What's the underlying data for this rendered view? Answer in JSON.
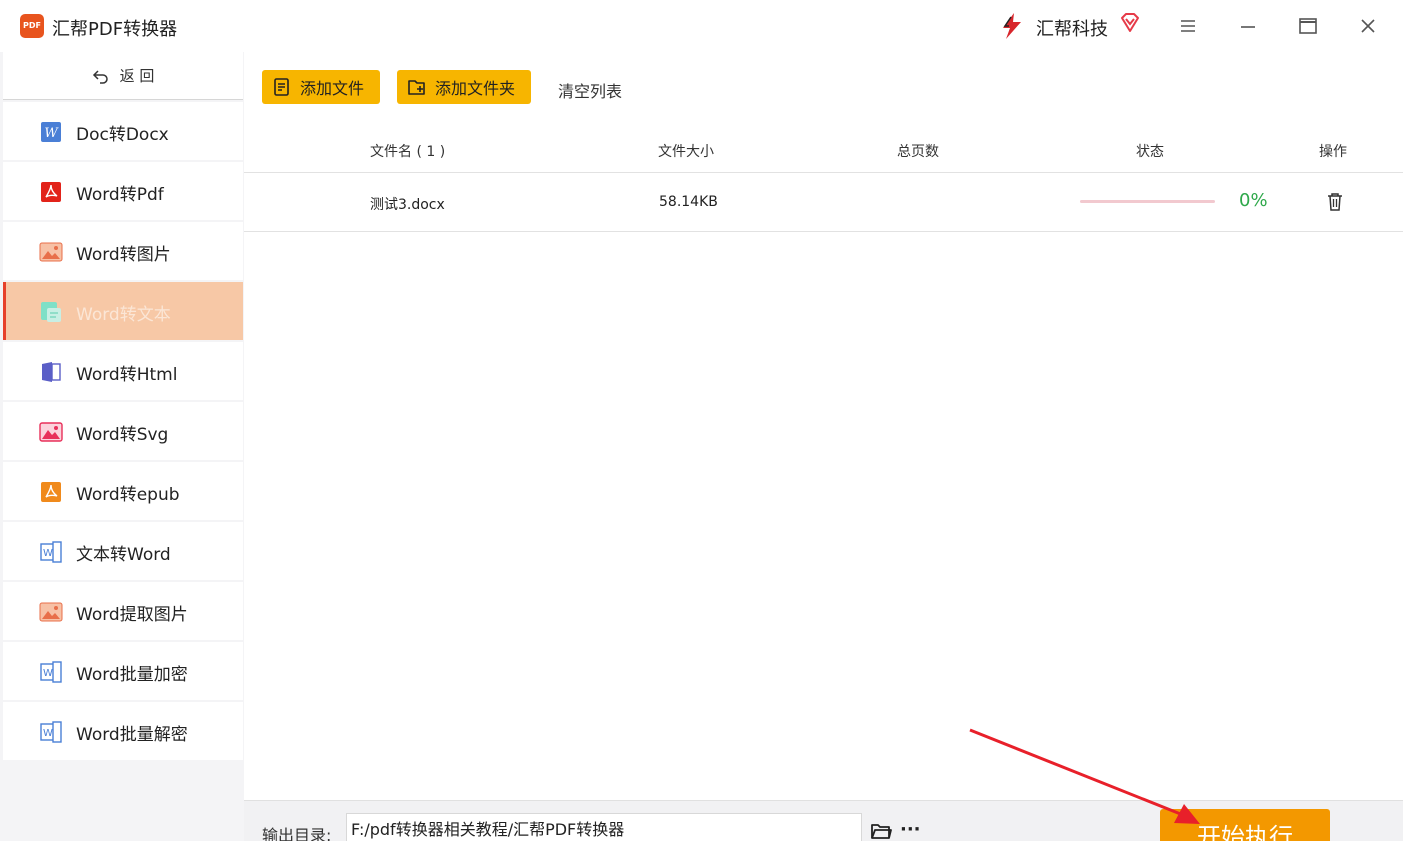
{
  "app": {
    "title": "汇帮PDF转换器",
    "logo_text": "PDF",
    "brand_name": "汇帮科技",
    "accent": "#f7b500",
    "start_color": "#f39800",
    "active_color": "#f7c8a6"
  },
  "window_controls": [
    "menu-icon",
    "minimize-icon",
    "maximize-icon",
    "close-icon"
  ],
  "sidebar": {
    "back_label": "返 回",
    "items": [
      {
        "label": "Doc转Docx",
        "icon": "word-w-icon"
      },
      {
        "label": "Word转Pdf",
        "icon": "pdf-icon"
      },
      {
        "label": "Word转图片",
        "icon": "image-icon"
      },
      {
        "label": "Word转文本",
        "icon": "text-icon",
        "active": true
      },
      {
        "label": "Word转Html",
        "icon": "html-icon"
      },
      {
        "label": "Word转Svg",
        "icon": "svg-image-icon"
      },
      {
        "label": "Word转epub",
        "icon": "epub-icon"
      },
      {
        "label": "文本转Word",
        "icon": "word-doc-icon"
      },
      {
        "label": "Word提取图片",
        "icon": "image-icon"
      },
      {
        "label": "Word批量加密",
        "icon": "word-doc-icon"
      },
      {
        "label": "Word批量解密",
        "icon": "word-doc-icon"
      }
    ]
  },
  "toolbar": {
    "add_file": "添加文件",
    "add_folder": "添加文件夹",
    "clear_list": "清空列表"
  },
  "table": {
    "headers": {
      "name": "文件名 ( 1 )",
      "size": "文件大小",
      "pages": "总页数",
      "status": "状态",
      "action": "操作"
    },
    "rows": [
      {
        "name": "测试3.docx",
        "size": "58.14KB",
        "pages": "",
        "progress": 0,
        "percent": "0%"
      }
    ]
  },
  "bottom": {
    "output_label": "输出目录:",
    "output_path": "F:/pdf转换器相关教程/汇帮PDF转换器",
    "more": "···",
    "start_button": "开始执行"
  }
}
